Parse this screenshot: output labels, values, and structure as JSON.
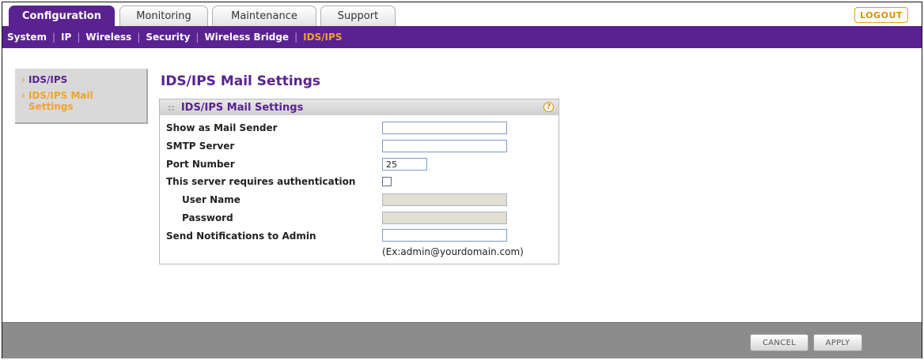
{
  "tabs": [
    {
      "label": "Configuration",
      "active": true
    },
    {
      "label": "Monitoring",
      "active": false
    },
    {
      "label": "Maintenance",
      "active": false
    },
    {
      "label": "Support",
      "active": false
    }
  ],
  "logout_label": "LOGOUT",
  "subnav": [
    {
      "label": "System",
      "active": false
    },
    {
      "label": "IP",
      "active": false
    },
    {
      "label": "Wireless",
      "active": false
    },
    {
      "label": "Security",
      "active": false
    },
    {
      "label": "Wireless Bridge",
      "active": false
    },
    {
      "label": "IDS/IPS",
      "active": true
    }
  ],
  "sidebar": {
    "items": [
      {
        "label": "IDS/IPS",
        "active": false
      },
      {
        "label": "IDS/IPS Mail Settings",
        "active": true
      }
    ]
  },
  "page_title": "IDS/IPS Mail Settings",
  "panel": {
    "title": "IDS/IPS Mail Settings",
    "help_icon": "?",
    "fields": {
      "mail_sender": {
        "label": "Show as Mail Sender",
        "value": ""
      },
      "smtp_server": {
        "label": "SMTP Server",
        "value": ""
      },
      "port_number": {
        "label": "Port Number",
        "value": "25"
      },
      "auth": {
        "label": "This server requires authentication",
        "checked": false
      },
      "user_name": {
        "label": "User Name",
        "value": "",
        "disabled": true
      },
      "password": {
        "label": "Password",
        "value": "",
        "disabled": true
      },
      "notify_admin": {
        "label": "Send Notifications to Admin",
        "value": ""
      }
    },
    "notify_hint": "(Ex:admin@yourdomain.com)"
  },
  "footer": {
    "cancel_label": "CANCEL",
    "apply_label": "APPLY"
  },
  "colors": {
    "brand_purple": "#5a2290",
    "accent_orange": "#f0a32a",
    "footer_gray": "#8c8c8c"
  }
}
